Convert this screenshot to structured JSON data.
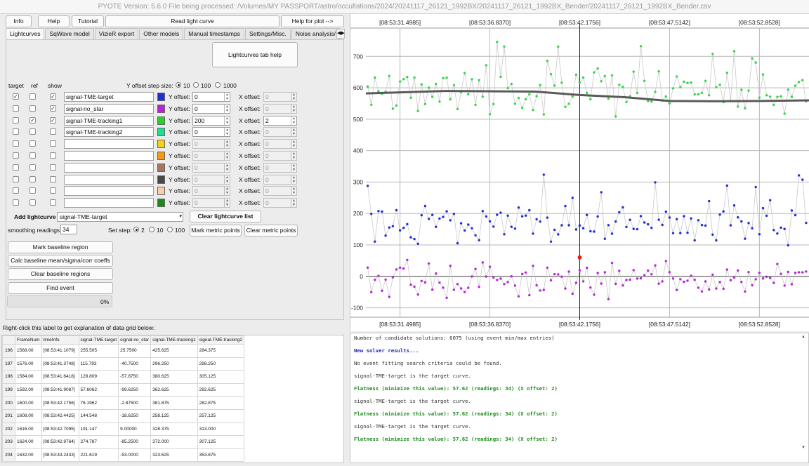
{
  "window": {
    "title": "PYOTE Version: 5.6.0   File being processed: /Volumes/MY PASSPORT/astro/occultations/2024/20241117_26121_1992BX/20241117_26121_1992BX_Bender/20241117_26121_1992BX_Bender.csv"
  },
  "toolbar": {
    "info": "Info",
    "help": "Help",
    "tutorial": "Tutorial",
    "read_lightcurve": "Read light curve",
    "help_for_plot": "Help for plot -->"
  },
  "tabs": [
    "Lightcurves",
    "SqWave model",
    "VizieR export",
    "Other models",
    "Manual timestamps",
    "Settings/Misc.",
    "Noise analysis/"
  ],
  "lightcurves_tab_help": "Lightcurves tab help",
  "headers": {
    "target": "target",
    "ref": "ref",
    "show": "show",
    "y_offset_step": "Y offset step size:",
    "y_offset": "Y offset:",
    "x_offset": "X offset:"
  },
  "step_options": [
    "10",
    "100",
    "1000"
  ],
  "rows": [
    {
      "target": true,
      "ref": false,
      "show": true,
      "name": "signal-TME-target",
      "color": "#1f2fd8",
      "y": "0",
      "x": "0",
      "active": true,
      "xenabled": false
    },
    {
      "target": false,
      "ref": false,
      "show": true,
      "name": "signal-no_star",
      "color": "#b526d6",
      "y": "0",
      "x": "0",
      "active": true,
      "xenabled": false
    },
    {
      "target": false,
      "ref": true,
      "show": true,
      "name": "signal-TME-tracking1",
      "color": "#26d426",
      "y": "200",
      "x": "2",
      "active": true,
      "xenabled": true
    },
    {
      "target": false,
      "ref": false,
      "show": false,
      "name": "signal-TME-tracking2",
      "color": "#20e090",
      "y": "0",
      "x": "0",
      "active": true,
      "xenabled": false
    },
    {
      "target": false,
      "ref": false,
      "show": false,
      "name": "",
      "color": "#f2d21e",
      "y": "0",
      "x": "0",
      "active": false,
      "xenabled": false
    },
    {
      "target": false,
      "ref": false,
      "show": false,
      "name": "",
      "color": "#f29a1a",
      "y": "0",
      "x": "0",
      "active": false,
      "xenabled": false
    },
    {
      "target": false,
      "ref": false,
      "show": false,
      "name": "",
      "color": "#a87660",
      "y": "0",
      "x": "0",
      "active": false,
      "xenabled": false
    },
    {
      "target": false,
      "ref": false,
      "show": false,
      "name": "",
      "color": "#484848",
      "y": "0",
      "x": "0",
      "active": false,
      "xenabled": false
    },
    {
      "target": false,
      "ref": false,
      "show": false,
      "name": "",
      "color": "#f8cda8",
      "y": "0",
      "x": "0",
      "active": false,
      "xenabled": false
    },
    {
      "target": false,
      "ref": false,
      "show": false,
      "name": "",
      "color": "#1a8a1a",
      "y": "0",
      "x": "0",
      "active": false,
      "xenabled": false
    }
  ],
  "add_lightcurve_label": "Add lightcurve",
  "add_lightcurve_value": "signal-TME-target",
  "clear_lightcurve_list": "Clear lightcurve list",
  "smoothing_label": "smoothing readings",
  "smoothing_value": "34",
  "set_step_label": "Set step:",
  "set_step_options": [
    "2",
    "10",
    "100"
  ],
  "mark_metric": "Mark metric points",
  "clear_metric": "Clear metric points",
  "mark_baseline": "Mark baseline region",
  "calc_baseline": "Calc baseline mean/sigma/corr coeffs",
  "clear_baseline": "Clear baseline regions",
  "find_event": "Find event",
  "progress": "0%",
  "grid_hint": "Right-click this label to get explanation of data grid below:",
  "table_columns": [
    "FrameNum",
    "timeInfo",
    "signal-TME-target",
    "signal-no_star",
    "signal-TME-tracking1",
    "signal-TME-tracking2"
  ],
  "table_rows": [
    {
      "idx": "196",
      "cells": [
        "1568.00",
        "[08:53:41.1079]",
        "255.505",
        "25.7500",
        "425.625",
        "284.375"
      ]
    },
    {
      "idx": "197",
      "cells": [
        "1576.00",
        "[08:53:41.3748]",
        "115.793",
        "-40.7500",
        "296.250",
        "298.250"
      ]
    },
    {
      "idx": "198",
      "cells": [
        "1584.00",
        "[08:53:41.6418]",
        "128.809",
        "-57.8750",
        "380.625",
        "305.125"
      ]
    },
    {
      "idx": "199",
      "cells": [
        "1592.00",
        "[08:53:41.9087]",
        "57.6062",
        "-99.6250",
        "362.625",
        "292.625"
      ]
    },
    {
      "idx": "200",
      "cells": [
        "1600.00",
        "[08:53:42.1756]",
        "76.1962",
        "-2.87500",
        "381.875",
        "282.875"
      ]
    },
    {
      "idx": "201",
      "cells": [
        "1608.00",
        "[08:53:42.4425]",
        "144.548",
        "-18.6250",
        "258.125",
        "257.125"
      ]
    },
    {
      "idx": "202",
      "cells": [
        "1616.00",
        "[08:53:42.7095]",
        "191.147",
        "9.00000",
        "328.375",
        "313.000"
      ]
    },
    {
      "idx": "203",
      "cells": [
        "1624.00",
        "[08:53:42.9764]",
        "274.787",
        "-85.2500",
        "372.000",
        "307.125"
      ]
    },
    {
      "idx": "204",
      "cells": [
        "1632.00",
        "[08:53:43.2433]",
        "221.619",
        "-53.0000",
        "323.625",
        "353.875"
      ]
    }
  ],
  "log_lines": [
    {
      "text": "Number of candidate solutions: 6075 (using event min/max entries)",
      "color": "#333333",
      "bold": false
    },
    {
      "text": "New solver results...",
      "color": "#1a2bb0",
      "bold": true
    },
    {
      "text": "No event fitting search criteria could be found.",
      "color": "#333333",
      "bold": false
    },
    {
      "text": "signal-TME-target is the target curve.",
      "color": "#333333",
      "bold": false
    },
    {
      "text": "Flatness (minimize this value): 57.62 (readings: 34) (X offset: 2)",
      "color": "#1a8a1a",
      "bold": true
    },
    {
      "text": "signal-TME-target is the target curve.",
      "color": "#333333",
      "bold": false
    },
    {
      "text": "Flatness (minimize this value): 57.62 (readings: 34) (X offset: 2)",
      "color": "#1a8a1a",
      "bold": true
    },
    {
      "text": "signal-TME-target is the target curve.",
      "color": "#333333",
      "bold": false
    },
    {
      "text": "Flatness (minimize this value): 57.62 (readings: 34) (X offset: 2)",
      "color": "#1a8a1a",
      "bold": true
    }
  ],
  "chart_data": {
    "type": "scatter",
    "title": "",
    "xlabel": "",
    "ylabel": "",
    "x_tick_labels": [
      "[08:53:31.4985]",
      "[08:53:36.8370]",
      "[08:53:42.1756]",
      "[08:53:47.5142]",
      "[08:53:52.8528]"
    ],
    "x_tick_frames": [
      1200,
      1400,
      1600,
      1800,
      2000
    ],
    "xlim": [
      1124,
      2112
    ],
    "y_ticks": [
      -100,
      0,
      100,
      200,
      300,
      400,
      500,
      600,
      700
    ],
    "ylim": [
      -130,
      790
    ],
    "grid": true,
    "cursor_frame": 1600,
    "highlight_point": {
      "frame": 1600,
      "value": 60
    },
    "series": [
      {
        "name": "signal-TME-tracking1",
        "color": "#33d64a",
        "base": 585,
        "amp": 55,
        "seed": 11
      },
      {
        "name": "signal-TME-target",
        "color": "#1f2fd8",
        "base": 170,
        "amp": 55,
        "seed": 23
      },
      {
        "name": "signal-no_star",
        "color": "#b526d6",
        "base": -10,
        "amp": 45,
        "seed": 37
      }
    ],
    "smoothed": {
      "color": "#5a5a5a",
      "points": [
        [
          1124,
          582
        ],
        [
          1300,
          590
        ],
        [
          1500,
          588
        ],
        [
          1600,
          577
        ],
        [
          1700,
          570
        ],
        [
          1800,
          558
        ],
        [
          1900,
          557
        ],
        [
          2000,
          558
        ],
        [
          2112,
          560
        ]
      ]
    }
  }
}
